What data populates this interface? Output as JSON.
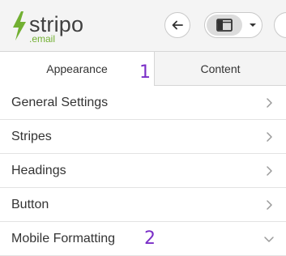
{
  "brand": {
    "name": "stripo",
    "sub": ".email",
    "accent": "#72b032"
  },
  "toolbar": {
    "back_icon": "arrow-left-icon",
    "layout_icon": "panel-layout-icon",
    "dropdown_icon": "chevron-down-icon"
  },
  "tabs": [
    {
      "label": "Appearance",
      "active": true
    },
    {
      "label": "Content",
      "active": false
    }
  ],
  "markers": [
    "1",
    "2"
  ],
  "marker_color": "#7a2ec7",
  "settings": [
    {
      "label": "General Settings",
      "icon": "chevron-right-icon"
    },
    {
      "label": "Stripes",
      "icon": "chevron-right-icon"
    },
    {
      "label": "Headings",
      "icon": "chevron-right-icon"
    },
    {
      "label": "Button",
      "icon": "chevron-right-icon"
    },
    {
      "label": "Mobile Formatting",
      "icon": "chevron-down-icon"
    }
  ]
}
